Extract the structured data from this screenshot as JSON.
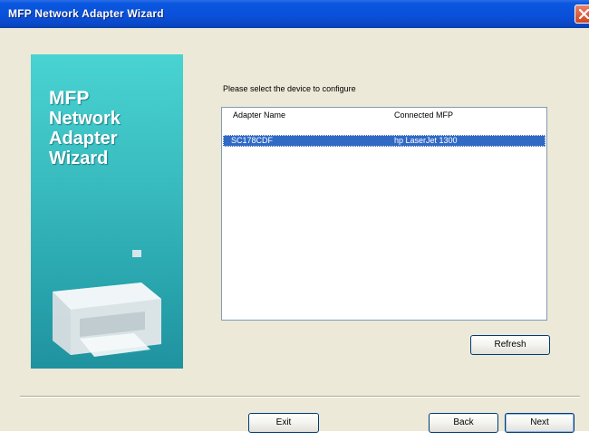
{
  "window": {
    "title": "MFP Network Adapter Wizard"
  },
  "banner": {
    "title_lines": [
      "MFP",
      "Network",
      "Adapter",
      "Wizard"
    ],
    "colors": {
      "top": "#49d3d2",
      "bottom": "#20929f"
    }
  },
  "main": {
    "instruction": "Please select the device to configure",
    "list": {
      "columns": [
        "Adapter Name",
        "Connected MFP"
      ],
      "rows": [
        {
          "adapter_name": "SC178CDF",
          "connected_mfp": "hp LaserJet 1300",
          "selected": true
        }
      ]
    },
    "refresh_label": "Refresh"
  },
  "footer": {
    "exit_label": "Exit",
    "back_label": "Back",
    "next_label": "Next"
  },
  "colors": {
    "titlebar": "#0a4fd8",
    "selection": "#316ac5",
    "dialog_bg": "#ece9d8"
  }
}
